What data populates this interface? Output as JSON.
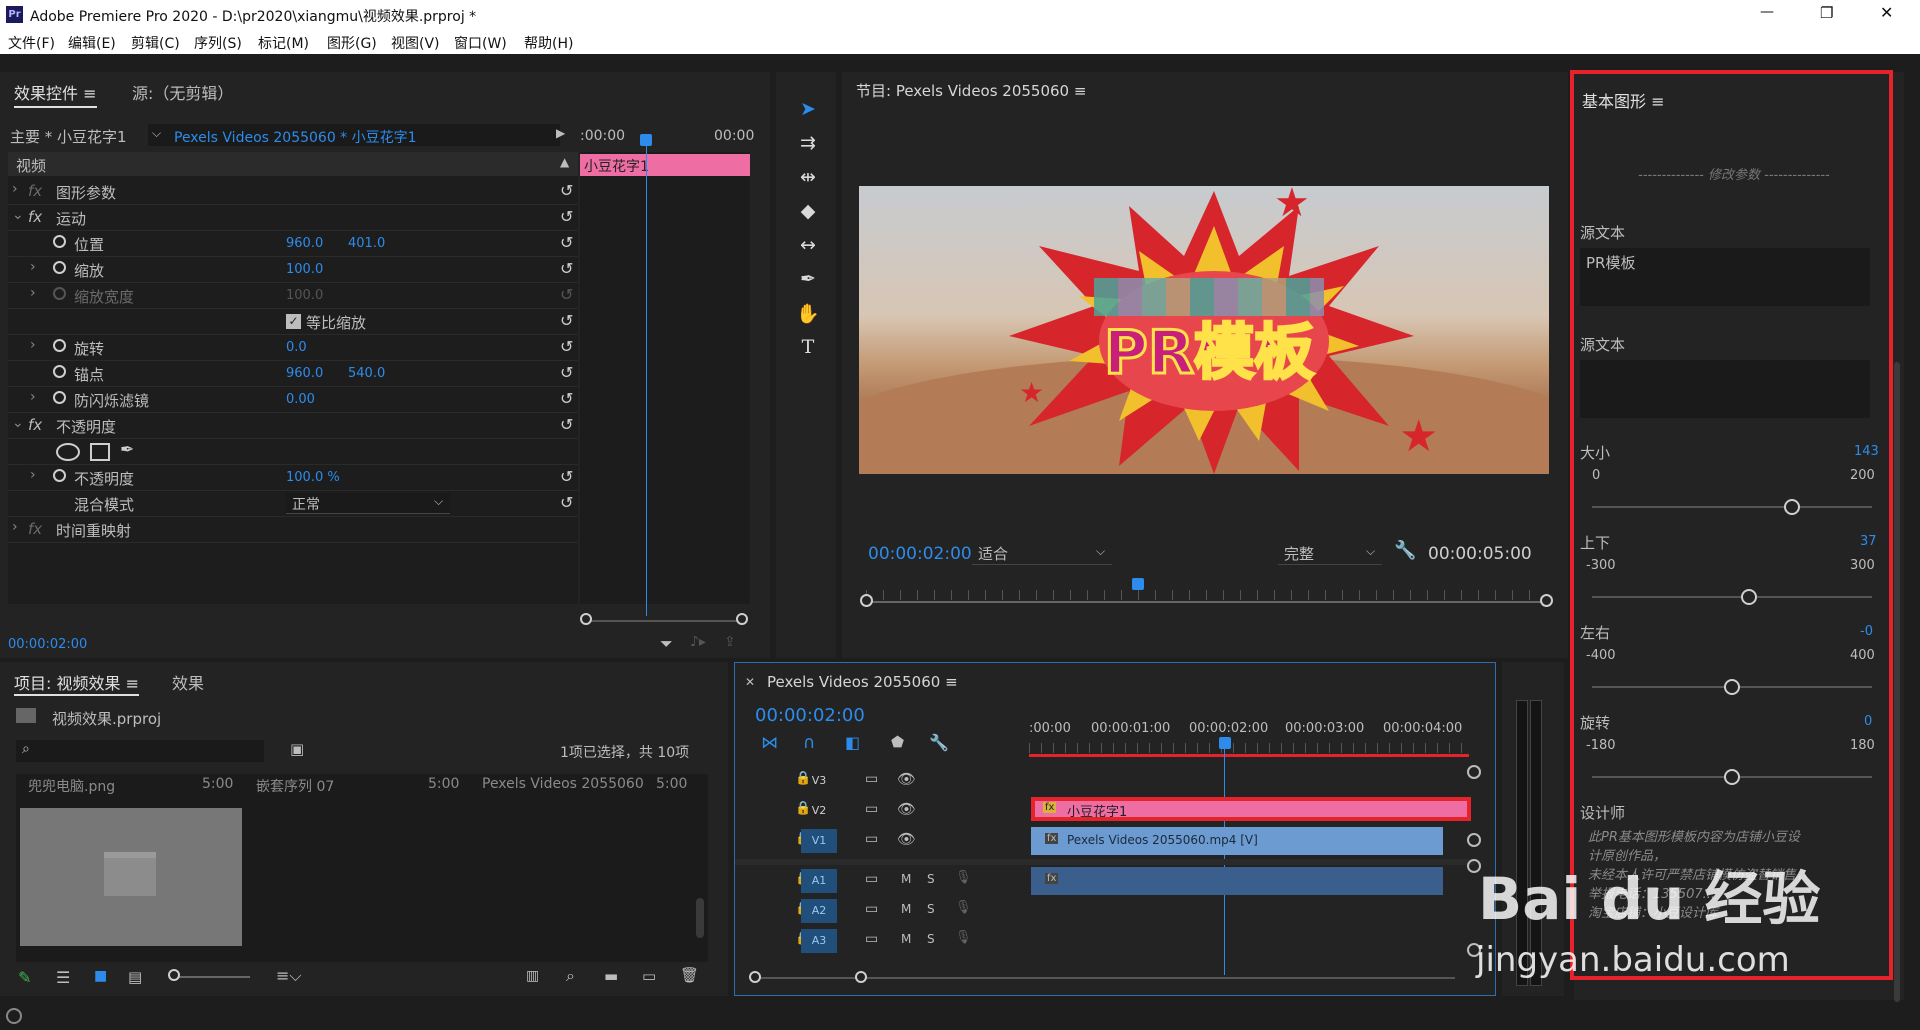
{
  "window": {
    "title": "Adobe Premiere Pro 2020 - D:\\pr2020\\xiangmu\\视频效果.prproj *",
    "app_icon": "Pr",
    "controls": {
      "minimize": "—",
      "maximize": "❐",
      "close": "✕"
    }
  },
  "menu": [
    "文件(F)",
    "编辑(E)",
    "剪辑(C)",
    "序列(S)",
    "标记(M)",
    "图形(G)",
    "视图(V)",
    "窗口(W)",
    "帮助(H)"
  ],
  "effect_controls": {
    "tab_label": "效果控件",
    "source_tab": "源:（无剪辑）",
    "master": "主要 * 小豆花字1",
    "clip": "Pexels Videos 2055060 * 小豆花字1",
    "time_start": ":00:00",
    "time_end": "00:00",
    "clip_bar_label": "小豆花字1",
    "section_video": "视频",
    "rows": {
      "shape_params": "图形参数",
      "motion": "运动",
      "position": "位置",
      "position_x": "960.0",
      "position_y": "401.0",
      "scale": "缩放",
      "scale_val": "100.0",
      "scale_width": "缩放宽度",
      "scale_width_val": "100.0",
      "uniform_scale": "等比缩放",
      "rotation": "旋转",
      "rotation_val": "0.0",
      "anchor": "锚点",
      "anchor_x": "960.0",
      "anchor_y": "540.0",
      "antiflicker": "防闪烁滤镜",
      "antiflicker_val": "0.00",
      "opacity_group": "不透明度",
      "opacity": "不透明度",
      "opacity_val": "100.0 %",
      "blend_mode": "混合模式",
      "blend_mode_val": "正常",
      "time_remap": "时间重映射"
    },
    "timecode": "00:00:02:00"
  },
  "program": {
    "title": "节目: Pexels Videos 2055060",
    "timecode": "00:00:02:00",
    "fit": "适合",
    "quality": "完整",
    "duration": "00:00:05:00",
    "title_text": "PR模板",
    "playhead_fraction": 0.4
  },
  "project": {
    "tab": "项目: 视频效果",
    "tab2": "效果",
    "file": "视频效果.prproj",
    "selection": "1项已选择，共 10项",
    "items": [
      {
        "name": "兜兜电脑.png",
        "dur": "5:00"
      },
      {
        "name": "嵌套序列 07",
        "dur": "5:00"
      },
      {
        "name": "Pexels Videos 2055060",
        "dur": "5:00"
      }
    ]
  },
  "timeline": {
    "title": "Pexels Videos 2055060",
    "timecode": "00:00:02:00",
    "ruler": [
      ":00:00",
      "00:00:01:00",
      "00:00:02:00",
      "00:00:03:00",
      "00:00:04:00"
    ],
    "tracks_video": [
      "V3",
      "V2",
      "V1"
    ],
    "tracks_audio": [
      "A1",
      "A2",
      "A3"
    ],
    "clip_v2": "小豆花字1",
    "clip_v1": "Pexels Videos 2055060.mp4 [V]",
    "mute": "M",
    "solo": "S",
    "fx": "fx"
  },
  "essential_graphics": {
    "title": "基本图形",
    "divider": "修改参数",
    "source_text_label": "源文本",
    "source_text_value": "PR模板",
    "source_text2_label": "源文本",
    "size": {
      "label": "大小",
      "value": "143",
      "min": "0",
      "max": "200",
      "fraction": 0.715
    },
    "updown": {
      "label": "上下",
      "value": "37",
      "min": "-300",
      "max": "300",
      "fraction": 0.56
    },
    "leftright": {
      "label": "左右",
      "value": "-0",
      "min": "-400",
      "max": "400",
      "fraction": 0.5
    },
    "rotate": {
      "label": "旋转",
      "value": "0",
      "min": "-180",
      "max": "180",
      "fraction": 0.5
    },
    "designer_label": "设计师",
    "designer_lines": [
      "此PR基本图形模板内容为店铺小豆设",
      "计原创作品，",
      "未经本人许可严禁店铺模仿盗替销售，",
      "举报电话：135507...",
      "淘宝店铺：小豆设计库"
    ]
  },
  "watermark": {
    "brand": "Bai du 经验",
    "url": "jingyan.baidu.com"
  },
  "colors": {
    "accent_blue": "#2d8ceb",
    "clip_pink": "#ee6ea4",
    "clip_blue": "#6c9bd2",
    "highlight_red": "#e6232a"
  }
}
